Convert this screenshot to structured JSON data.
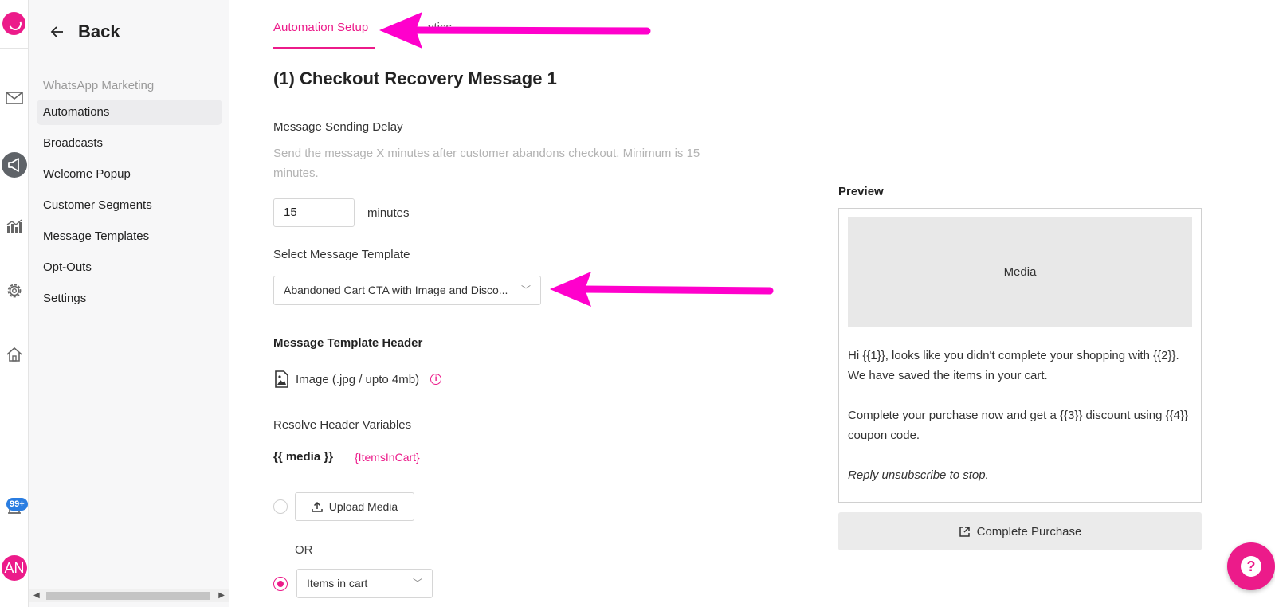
{
  "rail": {
    "icons": [
      "brand-logo",
      "mail-icon",
      "megaphone-icon",
      "analytics-icon",
      "gear-icon",
      "home-icon",
      "bell-icon"
    ],
    "notification_badge": "99+",
    "avatar_initials": "AN"
  },
  "sidebar": {
    "back_label": "Back",
    "section_title": "WhatsApp Marketing",
    "items": [
      {
        "label": "Automations",
        "active": true
      },
      {
        "label": "Broadcasts"
      },
      {
        "label": "Welcome Popup"
      },
      {
        "label": "Customer Segments"
      },
      {
        "label": "Message Templates"
      },
      {
        "label": "Opt-Outs"
      },
      {
        "label": "Settings"
      }
    ]
  },
  "tabs": [
    {
      "label": "Automation Setup",
      "active": true
    },
    {
      "label": "ytics"
    }
  ],
  "page_title": "(1) Checkout Recovery Message 1",
  "delay": {
    "label": "Message Sending Delay",
    "help": "Send the message X minutes after customer abandons checkout. Minimum is 15 minutes.",
    "value": "15",
    "unit": "minutes"
  },
  "template": {
    "label": "Select Message Template",
    "selected": "Abandoned Cart CTA with Image and Disco..."
  },
  "header_section": {
    "label": "Message Template Header",
    "type_text": "Image (.jpg / upto 4mb)",
    "resolve_label": "Resolve Header Variables",
    "variable_name": "{{ media }}",
    "variable_value": "{ItemsInCart}",
    "upload_label": "Upload Media",
    "or_text": "OR",
    "items_select": "Items in cart"
  },
  "preview": {
    "title": "Preview",
    "media_label": "Media",
    "line1": "Hi {{1}}, looks like you didn't complete your shopping with {{2}}. We have saved the items in your cart.",
    "line2": "Complete your purchase now and get a {{3}} discount using {{4}} coupon code.",
    "line3": "Reply unsubscribe to stop.",
    "button_label": "Complete Purchase"
  },
  "colors": {
    "accent": "#ec1b8a",
    "badge": "#2a7de1",
    "annotation_arrow": "#ff00cc"
  }
}
